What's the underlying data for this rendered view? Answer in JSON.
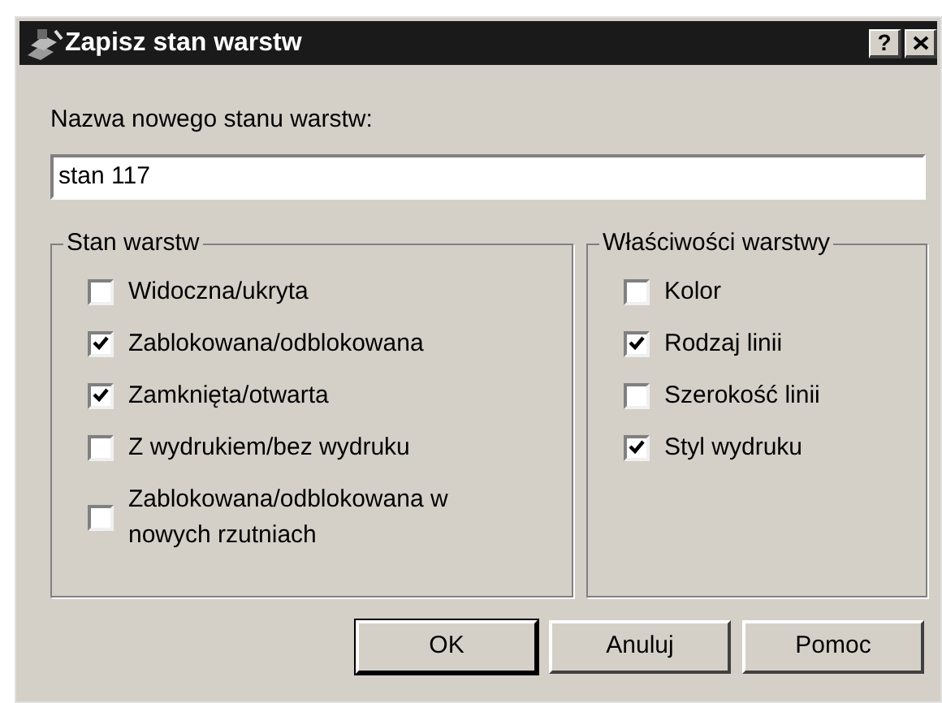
{
  "window": {
    "title": "Zapisz stan warstw",
    "help_button": "?"
  },
  "name_label": "Nazwa nowego stanu warstw:",
  "name_field": {
    "value": "stan 117"
  },
  "groups": [
    {
      "title": "Stan warstw",
      "items": [
        {
          "label": "Widoczna/ukryta",
          "checked": false
        },
        {
          "label": "Zablokowana/odblokowana",
          "checked": true
        },
        {
          "label": "Zamknięta/otwarta",
          "checked": true
        },
        {
          "label": "Z wydrukiem/bez wydruku",
          "checked": false
        },
        {
          "label": "Zablokowana/odblokowana w nowych rzutniach",
          "checked": false
        }
      ]
    },
    {
      "title": "Właściwości warstwy",
      "items": [
        {
          "label": "Kolor",
          "checked": false
        },
        {
          "label": "Rodzaj linii",
          "checked": true
        },
        {
          "label": "Szerokość linii",
          "checked": false
        },
        {
          "label": "Styl wydruku",
          "checked": true
        }
      ]
    }
  ],
  "buttons": [
    {
      "label": "OK",
      "default": true
    },
    {
      "label": "Anuluj",
      "default": false
    },
    {
      "label": "Pomoc",
      "default": false
    }
  ]
}
